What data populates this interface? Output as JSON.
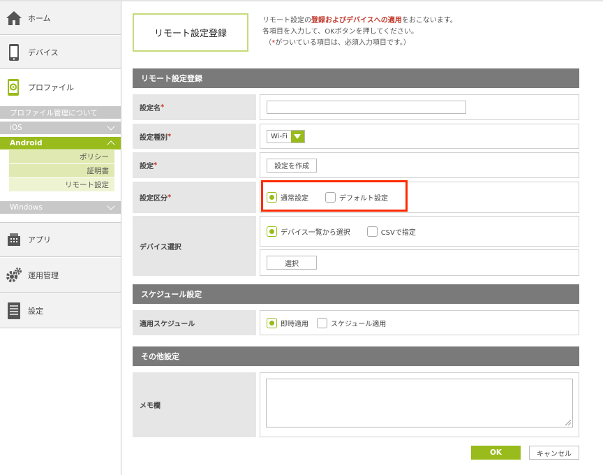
{
  "sidebar": {
    "home": "ホーム",
    "device": "デバイス",
    "profile": "プロファイル",
    "profile_about": "プロファイル管理について",
    "ios": "iOS",
    "android": "Android",
    "android_items": [
      "ポリシー",
      "証明書",
      "リモート設定"
    ],
    "windows": "Windows",
    "app": "アプリ",
    "operation": "運用管理",
    "settings": "設定"
  },
  "page": {
    "title": "リモート設定登録",
    "intro_1a": "リモート設定の",
    "intro_1b": "登録およびデバイスへの適用",
    "intro_1c": "をおこないます。",
    "intro_2": "各項目を入力して、OKボタンを押してください。",
    "intro_3a": "（",
    "intro_3b": "*",
    "intro_3c": "がついている項目は、必須入力項目です。）"
  },
  "form": {
    "section_main": "リモート設定登録",
    "name_label": "設定名",
    "name_value": "",
    "type_label": "設定種別",
    "type_value": "Wi-Fi",
    "setting_label": "設定",
    "create_button": "設定を作成",
    "category_label": "設定区分",
    "category_normal": "通常設定",
    "category_default": "デフォルト設定",
    "device_label": "デバイス選択",
    "device_from_list": "デバイス一覧から選択",
    "device_csv": "CSVで指定",
    "select_button": "選択",
    "section_schedule": "スケジュール設定",
    "schedule_label": "適用スケジュール",
    "schedule_now": "即時適用",
    "schedule_later": "スケジュール適用",
    "section_other": "その他設定",
    "memo_label": "メモ欄",
    "memo_value": "",
    "required_mark": "*"
  },
  "actions": {
    "ok": "OK",
    "cancel": "キャンセル"
  },
  "colors": {
    "accent": "#99bb1c",
    "highlight": "#ff2a00",
    "section_bar": "#7a7a7a"
  }
}
